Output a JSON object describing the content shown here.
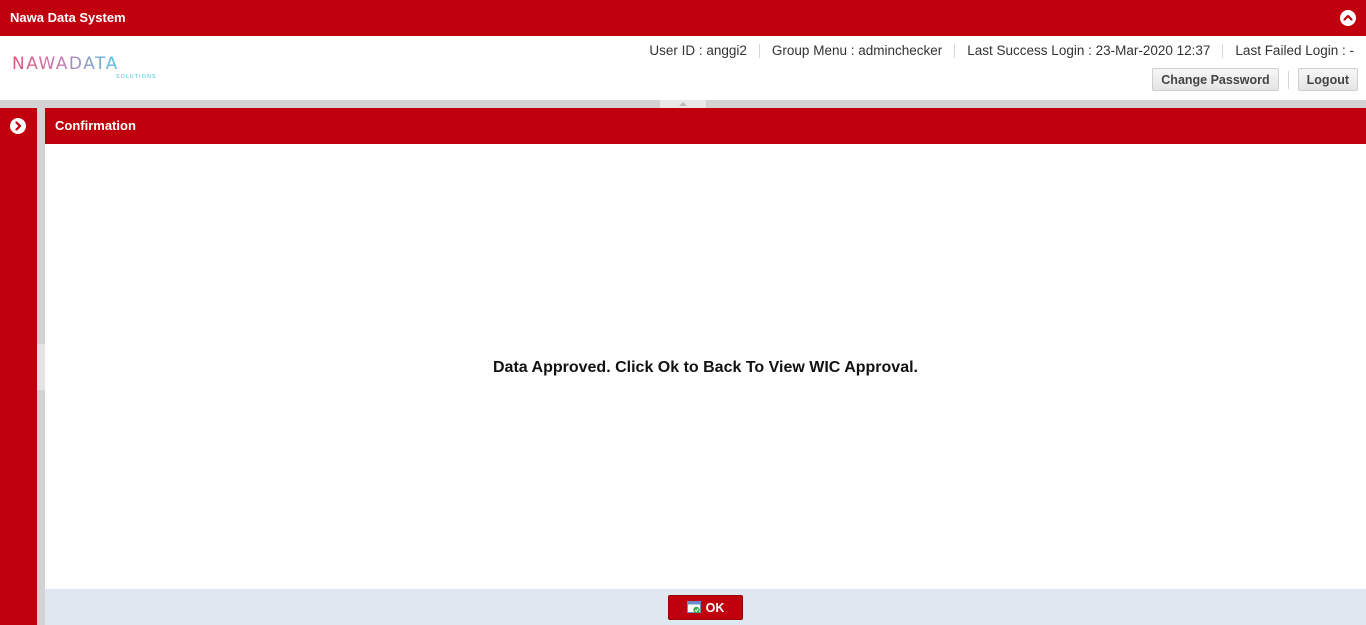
{
  "app": {
    "title": "Nawa Data System"
  },
  "logo": {
    "text": "NAWADATA",
    "subtext": "SOLUTIONS"
  },
  "user_info": {
    "user_id": "User ID : anggi2",
    "group_menu": "Group Menu : adminchecker",
    "last_success_login": "Last Success Login : 23-Mar-2020 12:37",
    "last_failed_login": "Last Failed Login : -"
  },
  "actions": {
    "change_password": "Change Password",
    "logout": "Logout"
  },
  "panel": {
    "title": "Confirmation",
    "message": "Data Approved. Click Ok to Back To View WIC Approval.",
    "ok_label": "OK"
  },
  "colors": {
    "brand_red": "#c0000c",
    "footer_bg": "#dfe8f1"
  }
}
